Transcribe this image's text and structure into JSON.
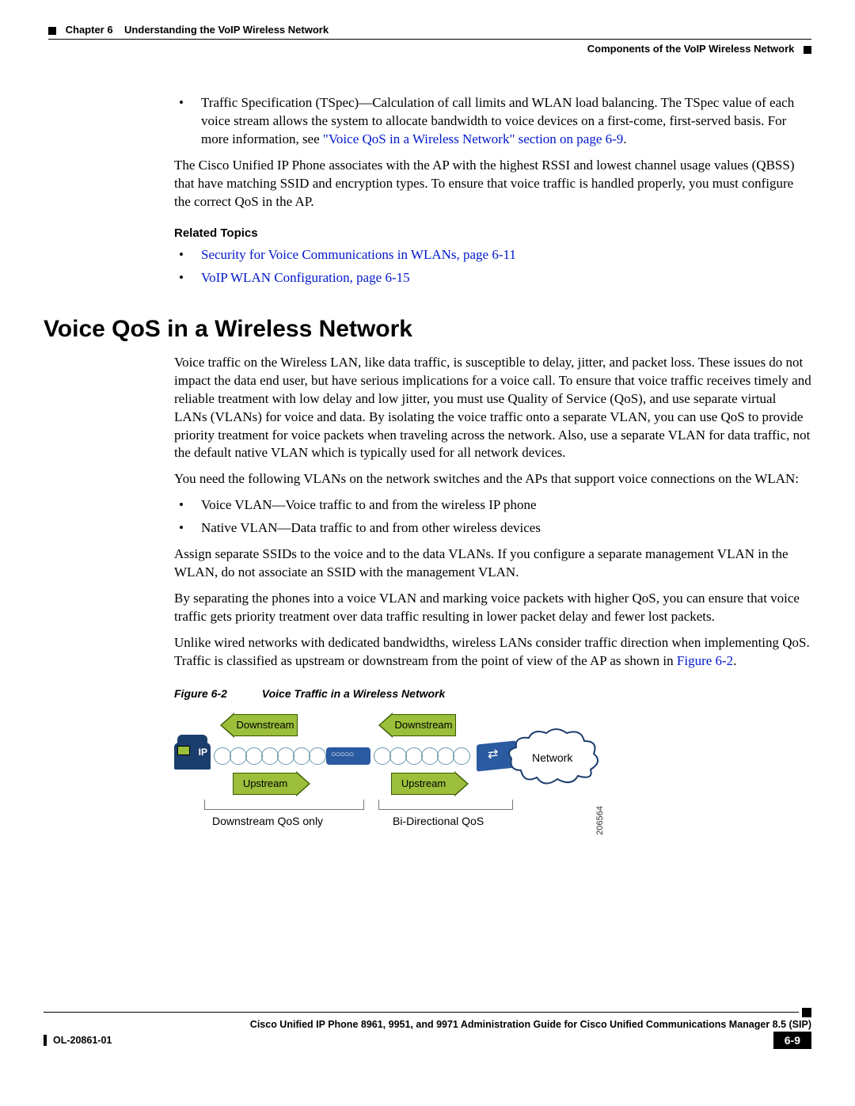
{
  "header": {
    "chapter_label": "Chapter 6",
    "chapter_title": "Understanding the VoIP Wireless Network",
    "section_title": "Components of the VoIP Wireless Network"
  },
  "intro_bullet": {
    "lead": "Traffic Specification (TSpec)—Calculation of call limits and WLAN load balancing. The TSpec value of each voice stream allows the system to allocate bandwidth to voice devices on a first-come, first-served basis. For more information, see ",
    "link": "\"Voice QoS in a Wireless Network\" section on page 6-9",
    "trail": "."
  },
  "intro_para": "The Cisco Unified IP Phone associates with the AP with the highest RSSI and lowest channel usage values (QBSS) that have matching SSID and encryption types. To ensure that voice traffic is handled properly, you must configure the correct QoS in the AP.",
  "related_topics": {
    "heading": "Related Topics",
    "items": [
      "Security for Voice Communications in WLANs, page 6-11",
      "VoIP WLAN Configuration, page 6-15"
    ]
  },
  "h1": "Voice QoS in a Wireless Network",
  "p1": "Voice traffic on the Wireless LAN, like data traffic, is susceptible to delay, jitter, and packet loss. These issues do not impact the data end user, but have serious implications for a voice call. To ensure that voice traffic receives timely and reliable treatment with low delay and low jitter, you must use Quality of Service (QoS), and use separate virtual LANs (VLANs) for voice and data. By isolating the voice traffic onto a separate VLAN, you can use QoS to provide priority treatment for voice packets when traveling across the network. Also, use a separate VLAN for data traffic, not the default native VLAN which is typically used for all network devices.",
  "p2": "You need the following VLANs on the network switches and the APs that support voice connections on the WLAN:",
  "vlan_bullets": [
    "Voice VLAN—Voice traffic to and from the wireless IP phone",
    "Native VLAN—Data traffic to and from other wireless devices"
  ],
  "p3": "Assign separate SSIDs to the voice and to the data VLANs. If you configure a separate management VLAN in the WLAN, do not associate an SSID with the management VLAN.",
  "p4": "By separating the phones into a voice VLAN and marking voice packets with higher QoS, you can ensure that voice traffic gets priority treatment over data traffic resulting in lower packet delay and fewer lost packets.",
  "p5_lead": "Unlike wired networks with dedicated bandwidths, wireless LANs consider traffic direction when implementing QoS. Traffic is classified as upstream or downstream from the point of view of the AP as shown in ",
  "p5_link": "Figure 6-2",
  "p5_trail": ".",
  "figure": {
    "num": "Figure 6-2",
    "title": "Voice Traffic in a Wireless Network",
    "labels": {
      "downstream": "Downstream",
      "upstream": "Upstream",
      "network": "Network",
      "ip": "IP",
      "ds_qos": "Downstream QoS only",
      "bi_qos": "Bi-Directional QoS",
      "id": "206564"
    }
  },
  "footer": {
    "guide": "Cisco Unified IP Phone 8961, 9951, and 9971 Administration Guide for Cisco Unified Communications Manager 8.5 (SIP)",
    "ol": "OL-20861-01",
    "page": "6-9"
  }
}
